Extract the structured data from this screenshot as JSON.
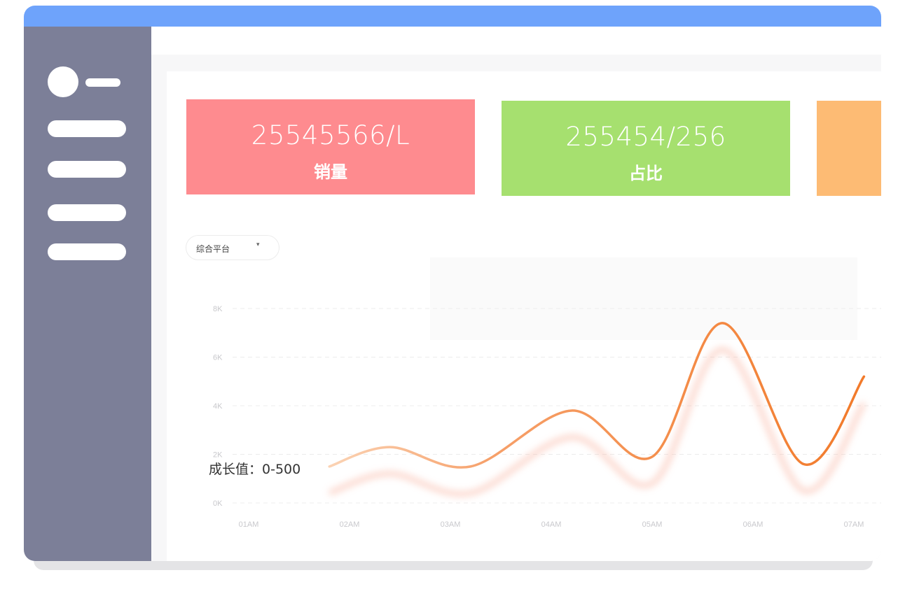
{
  "cards": [
    {
      "value": "25545566/L",
      "label": "销量",
      "color": "#fe8b8f"
    },
    {
      "value": "255454/256",
      "label": "占比",
      "color": "#a6e06f"
    },
    {
      "value": "",
      "label": "",
      "color": "#fdbb74"
    }
  ],
  "filter": {
    "selected": "综合平台",
    "caret": "▾"
  },
  "annotation": "成长值：0-500",
  "chart_data": {
    "type": "line",
    "x": [
      "01AM",
      "02AM",
      "03AM",
      "04AM",
      "05AM",
      "06AM",
      "07AM"
    ],
    "yticks": [
      "0K",
      "2K",
      "4K",
      "6K",
      "8K"
    ],
    "ylim": [
      0,
      8000
    ],
    "grid": true,
    "series": [
      {
        "color": "#f27a2a",
        "points": [
          [
            1.8,
            1500
          ],
          [
            2.4,
            2300
          ],
          [
            3.2,
            1500
          ],
          [
            4.2,
            3800
          ],
          [
            5.0,
            1900
          ],
          [
            5.7,
            7400
          ],
          [
            6.5,
            1600
          ],
          [
            7.1,
            5200
          ]
        ]
      }
    ]
  }
}
